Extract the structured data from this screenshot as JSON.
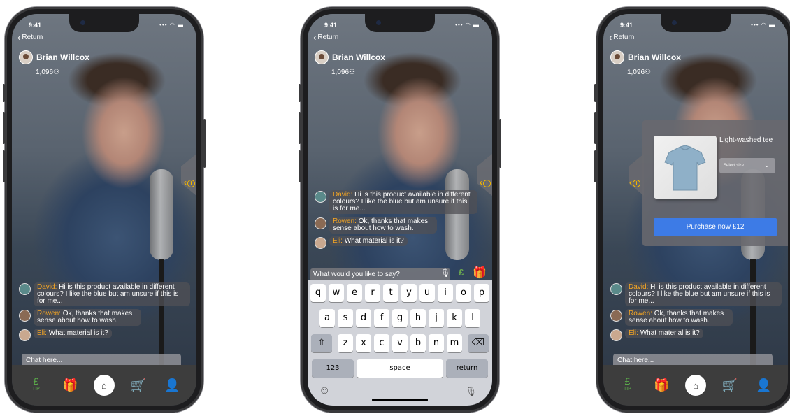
{
  "status": {
    "time": "9:41",
    "icons": "••• ◠ ▬"
  },
  "header": {
    "return_label": "Return",
    "streamer_name": "Brian Willcox",
    "viewer_count": "1,096"
  },
  "chat": [
    {
      "user": "David:",
      "text": "Hi is this product available in different colours? I like the blue but am unsure if this is for me..."
    },
    {
      "user": "Rowen:",
      "text": "Ok, thanks that makes sense about how to wash."
    },
    {
      "user": "Eli:",
      "text": "What material is it?"
    }
  ],
  "chat_input_placeholder": "Chat here...",
  "message_input_placeholder": "What would you like to say?",
  "nav": {
    "tip_symbol": "£",
    "tip_label": "TIP",
    "gift": "🎁",
    "home": "⌂",
    "cart": "🛒",
    "profile": "👤"
  },
  "keyboard": {
    "row1": [
      "q",
      "w",
      "e",
      "r",
      "t",
      "y",
      "u",
      "i",
      "o",
      "p"
    ],
    "row2": [
      "a",
      "s",
      "d",
      "f",
      "g",
      "h",
      "j",
      "k",
      "l"
    ],
    "row3": [
      "z",
      "x",
      "c",
      "v",
      "b",
      "n",
      "m"
    ],
    "shift": "⇧",
    "backspace": "⌫",
    "numbers": "123",
    "space": "space",
    "return": "return",
    "emoji": "☺",
    "mic": "🎙"
  },
  "product": {
    "name": "Light-washed tee",
    "size_placeholder": "Select size",
    "purchase_label": "Purchase now £12"
  },
  "side_tab_icon": "‹"
}
